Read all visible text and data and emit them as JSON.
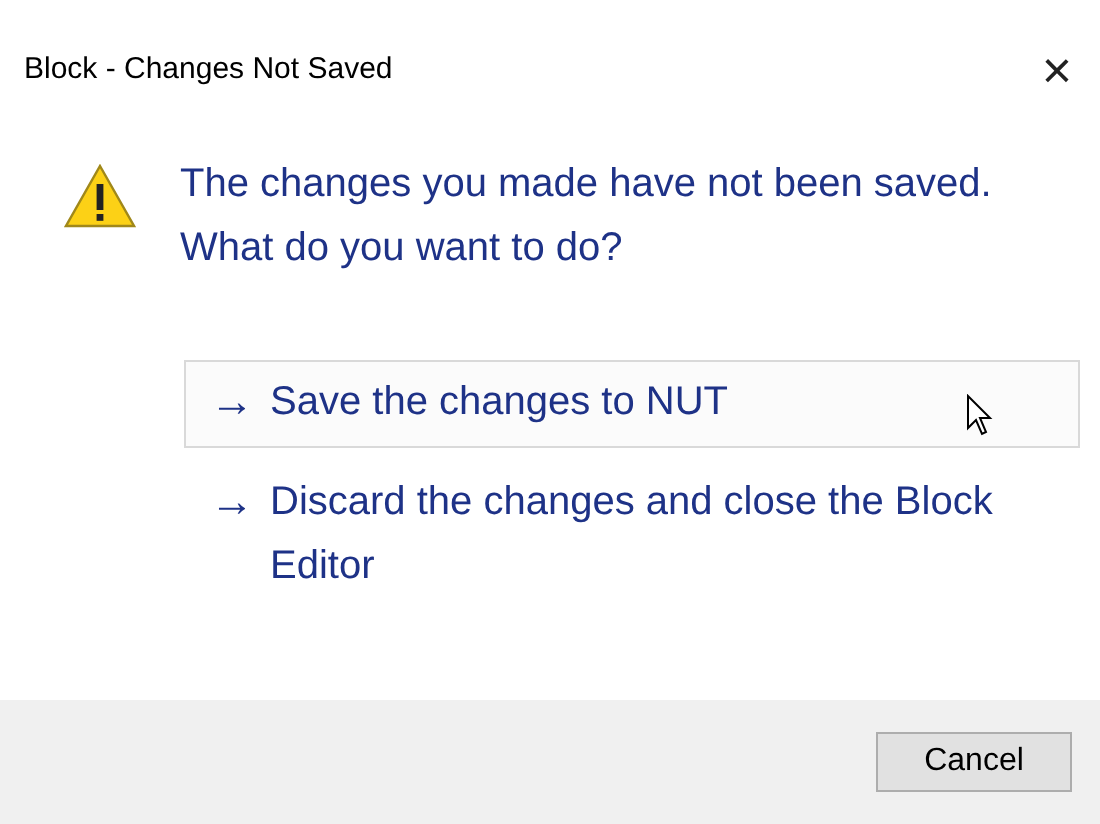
{
  "window": {
    "title": "Block - Changes Not Saved",
    "close": "×"
  },
  "message": "The changes you made have not been saved. What do you want to do?",
  "command_links": [
    {
      "arrow": "→",
      "label": "Save the changes to NUT",
      "hovered": true
    },
    {
      "arrow": "→",
      "label": "Discard the changes and close the Block Editor",
      "hovered": false
    }
  ],
  "buttons": [
    {
      "label": "Cancel"
    }
  ]
}
